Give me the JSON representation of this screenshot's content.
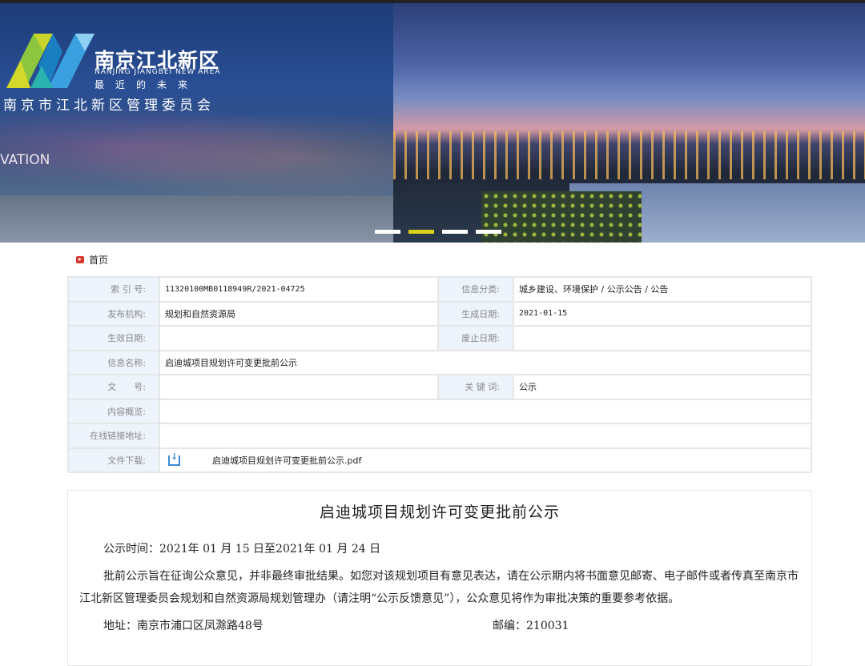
{
  "banner": {
    "logo_name": "南京江北新区",
    "logo_en": "NANJING JIANGBEI NEW AREA",
    "logo_slogan": "最近的未来",
    "org": "南京市江北新区管理委员会",
    "tagline_fragment": "VATION",
    "slides": 4,
    "active_slide": 2
  },
  "breadcrumb": {
    "home": "首页"
  },
  "meta": {
    "index_label": "索 引 号:",
    "index_value": "11320100MB0118949R/2021-04725",
    "category_label": "信息分类:",
    "category_value": "城乡建设、环境保护 / 公示公告 / 公告",
    "publisher_label": "发布机构:",
    "publisher_value": "规划和自然资源局",
    "created_label": "生成日期:",
    "created_value": "2021-01-15",
    "effective_label": "生效日期:",
    "effective_value": "",
    "expiry_label": "废止日期:",
    "expiry_value": "",
    "name_label": "信息名称:",
    "name_value": "启迪城项目规划许可变更批前公示",
    "docno_label": "文　　号:",
    "docno_value": "",
    "keywords_label": "关 键 词:",
    "keywords_value": "公示",
    "summary_label": "内容概览:",
    "summary_value": "",
    "link_label": "在线链接地址:",
    "link_value": "",
    "file_label": "文件下载:",
    "file_value": "启迪城项目规划许可变更批前公示.pdf"
  },
  "article": {
    "title": "启迪城项目规划许可变更批前公示",
    "period": "公示时间：2021年 01 月 15 日至2021年 01 月 24 日",
    "body": "批前公示旨在征询公众意见，并非最终审批结果。如您对该规划项目有意见表达，请在公示期内将书面意见邮寄、电子邮件或者传真至南京市江北新区管理委员会规划和自然资源局规划管理办（请注明“公示反馈意见”），公众意见将作为审批决策的重要参考依据。",
    "address": "地址：南京市浦口区凤滁路48号",
    "postcode": "邮编：210031"
  }
}
